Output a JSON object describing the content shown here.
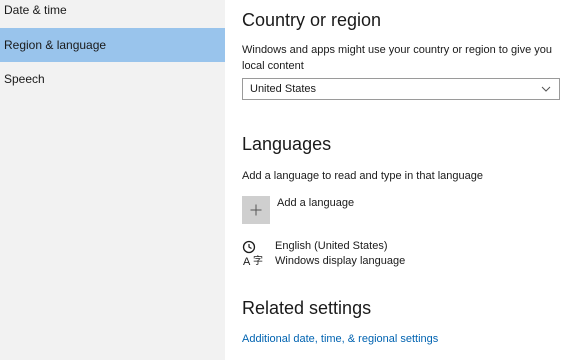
{
  "nav": {
    "items": [
      {
        "label": "Date & time"
      },
      {
        "label": "Region & language"
      },
      {
        "label": "Speech"
      }
    ],
    "selected_color": "#99c4ec"
  },
  "country": {
    "heading": "Country or region",
    "description": "Windows and apps might use your country or region to give you local content",
    "selected_value": "United States",
    "dropdown_icon": "chevron-down-icon"
  },
  "languages": {
    "heading": "Languages",
    "description": "Add a language to read and type in that language",
    "add_label": "Add a language",
    "add_icon": "plus-icon",
    "items": [
      {
        "name": "English (United States)",
        "detail": "Windows display language",
        "icon": "language-icon"
      }
    ]
  },
  "related": {
    "heading": "Related settings",
    "link_label": "Additional date, time, & regional settings",
    "link_color": "#0063b1"
  }
}
